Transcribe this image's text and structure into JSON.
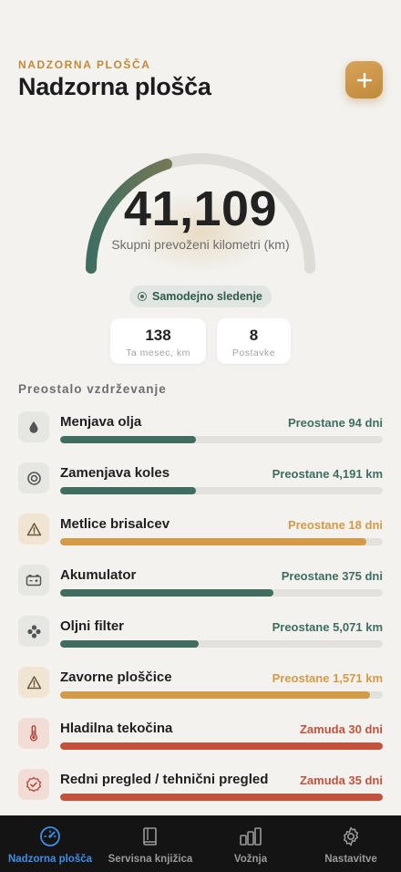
{
  "header": {
    "eyebrow": "NADZORNA PLOŠČA",
    "title": "Nadzorna plošča",
    "add_icon": "plus-icon"
  },
  "gauge": {
    "value": "41,109",
    "label": "Skupni prevoženi kilometri (km)",
    "fill_fraction": 0.4
  },
  "tracking": {
    "label": "Samodejno sledenje"
  },
  "stats": [
    {
      "value": "138",
      "label": "Ta mesec, km"
    },
    {
      "value": "8",
      "label": "Postavke"
    }
  ],
  "maintenance": {
    "title": "Preostalo vzdrževanje",
    "items": [
      {
        "name": "Menjava olja",
        "status": "Preostane 94 dni",
        "state": "ok",
        "progress": 0.42,
        "icon": "droplet-icon"
      },
      {
        "name": "Zamenjava koles",
        "status": "Preostane 4,191 km",
        "state": "ok",
        "progress": 0.42,
        "icon": "tire-icon"
      },
      {
        "name": "Metlice brisalcev",
        "status": "Preostane 18 dni",
        "state": "warn",
        "progress": 0.95,
        "icon": "warning-icon"
      },
      {
        "name": "Akumulator",
        "status": "Preostane 375 dni",
        "state": "ok",
        "progress": 0.66,
        "icon": "battery-icon"
      },
      {
        "name": "Oljni filter",
        "status": "Preostane 5,071 km",
        "state": "ok",
        "progress": 0.43,
        "icon": "filter-icon"
      },
      {
        "name": "Zavorne ploščice",
        "status": "Preostane 1,571 km",
        "state": "warn",
        "progress": 0.96,
        "icon": "warning-icon"
      },
      {
        "name": "Hladilna tekočina",
        "status": "Zamuda 30 dni",
        "state": "overdue",
        "progress": 1.0,
        "icon": "thermometer-icon"
      },
      {
        "name": "Redni pregled / tehnični pregled",
        "status": "Zamuda 35 dni",
        "state": "overdue",
        "progress": 1.0,
        "icon": "check-badge-icon"
      }
    ]
  },
  "colors": {
    "ok": "#3f6e60",
    "warn": "#d39a48",
    "overdue": "#c2523c",
    "accent": "#c99343",
    "tab_active": "#3f8ee6",
    "tab_inactive": "#9a9a9a"
  },
  "tabbar": {
    "tabs": [
      {
        "label": "Nadzorna plošča",
        "icon": "speedometer-icon",
        "active": true
      },
      {
        "label": "Servisna knjižica",
        "icon": "book-icon",
        "active": false
      },
      {
        "label": "Vožnja",
        "icon": "bar-chart-icon",
        "active": false
      },
      {
        "label": "Nastavitve",
        "icon": "gear-icon",
        "active": false
      }
    ]
  }
}
